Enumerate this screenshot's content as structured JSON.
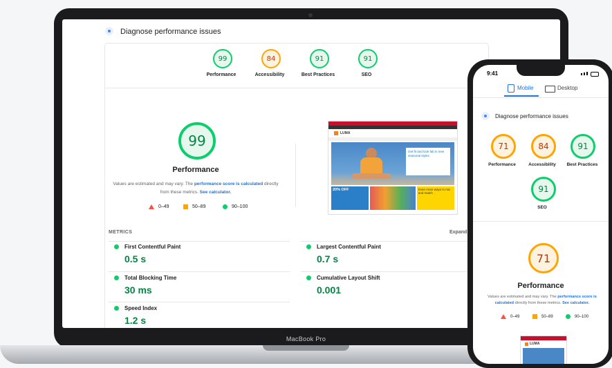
{
  "laptop": {
    "brand": "MacBook Pro",
    "header_title": "Diagnose performance issues",
    "categories": [
      {
        "label": "Performance",
        "score": "99"
      },
      {
        "label": "Accessibility",
        "score": "84"
      },
      {
        "label": "Best Practices",
        "score": "91"
      },
      {
        "label": "SEO",
        "score": "91"
      }
    ],
    "main_score": "99",
    "main_label": "Performance",
    "note_prefix": "Values are estimated and may vary. The ",
    "note_link1": "performance score is calculated",
    "note_mid": " directly from these metrics. ",
    "note_link2": "See calculator.",
    "legend": [
      "0–49",
      "50–89",
      "90–100"
    ],
    "metrics_title": "METRICS",
    "expand": "Expand",
    "metrics": [
      {
        "name": "First Contentful Paint",
        "value": "0.5 s"
      },
      {
        "name": "Largest Contentful Paint",
        "value": "0.7 s"
      },
      {
        "name": "Total Blocking Time",
        "value": "30 ms"
      },
      {
        "name": "Cumulative Layout Shift",
        "value": "0.001"
      },
      {
        "name": "Speed Index",
        "value": "1.2 s"
      }
    ],
    "preview": {
      "logo": "LUMA",
      "promo1": "Get fit and look fab in new seasonal styles",
      "promo2": "20% OFF",
      "promo3": "Even more ways to mix and match"
    }
  },
  "phone": {
    "time": "9:41",
    "tabs": [
      "Mobile",
      "Desktop"
    ],
    "header_title": "Diagnose performance issues",
    "categories": [
      {
        "label": "Performance",
        "score": "71"
      },
      {
        "label": "Accessibility",
        "score": "84"
      },
      {
        "label": "Best Practices",
        "score": "91"
      },
      {
        "label": "SEO",
        "score": "91"
      }
    ],
    "main_score": "71",
    "main_label": "Performance",
    "note_prefix": "Values are estimated and may vary. The ",
    "note_link1": "performance score is calculated",
    "note_mid": " directly from these metrics. ",
    "note_link2": "See calculator.",
    "legend": [
      "0–49",
      "50–89",
      "90–100"
    ],
    "preview_logo": "LUMA"
  }
}
